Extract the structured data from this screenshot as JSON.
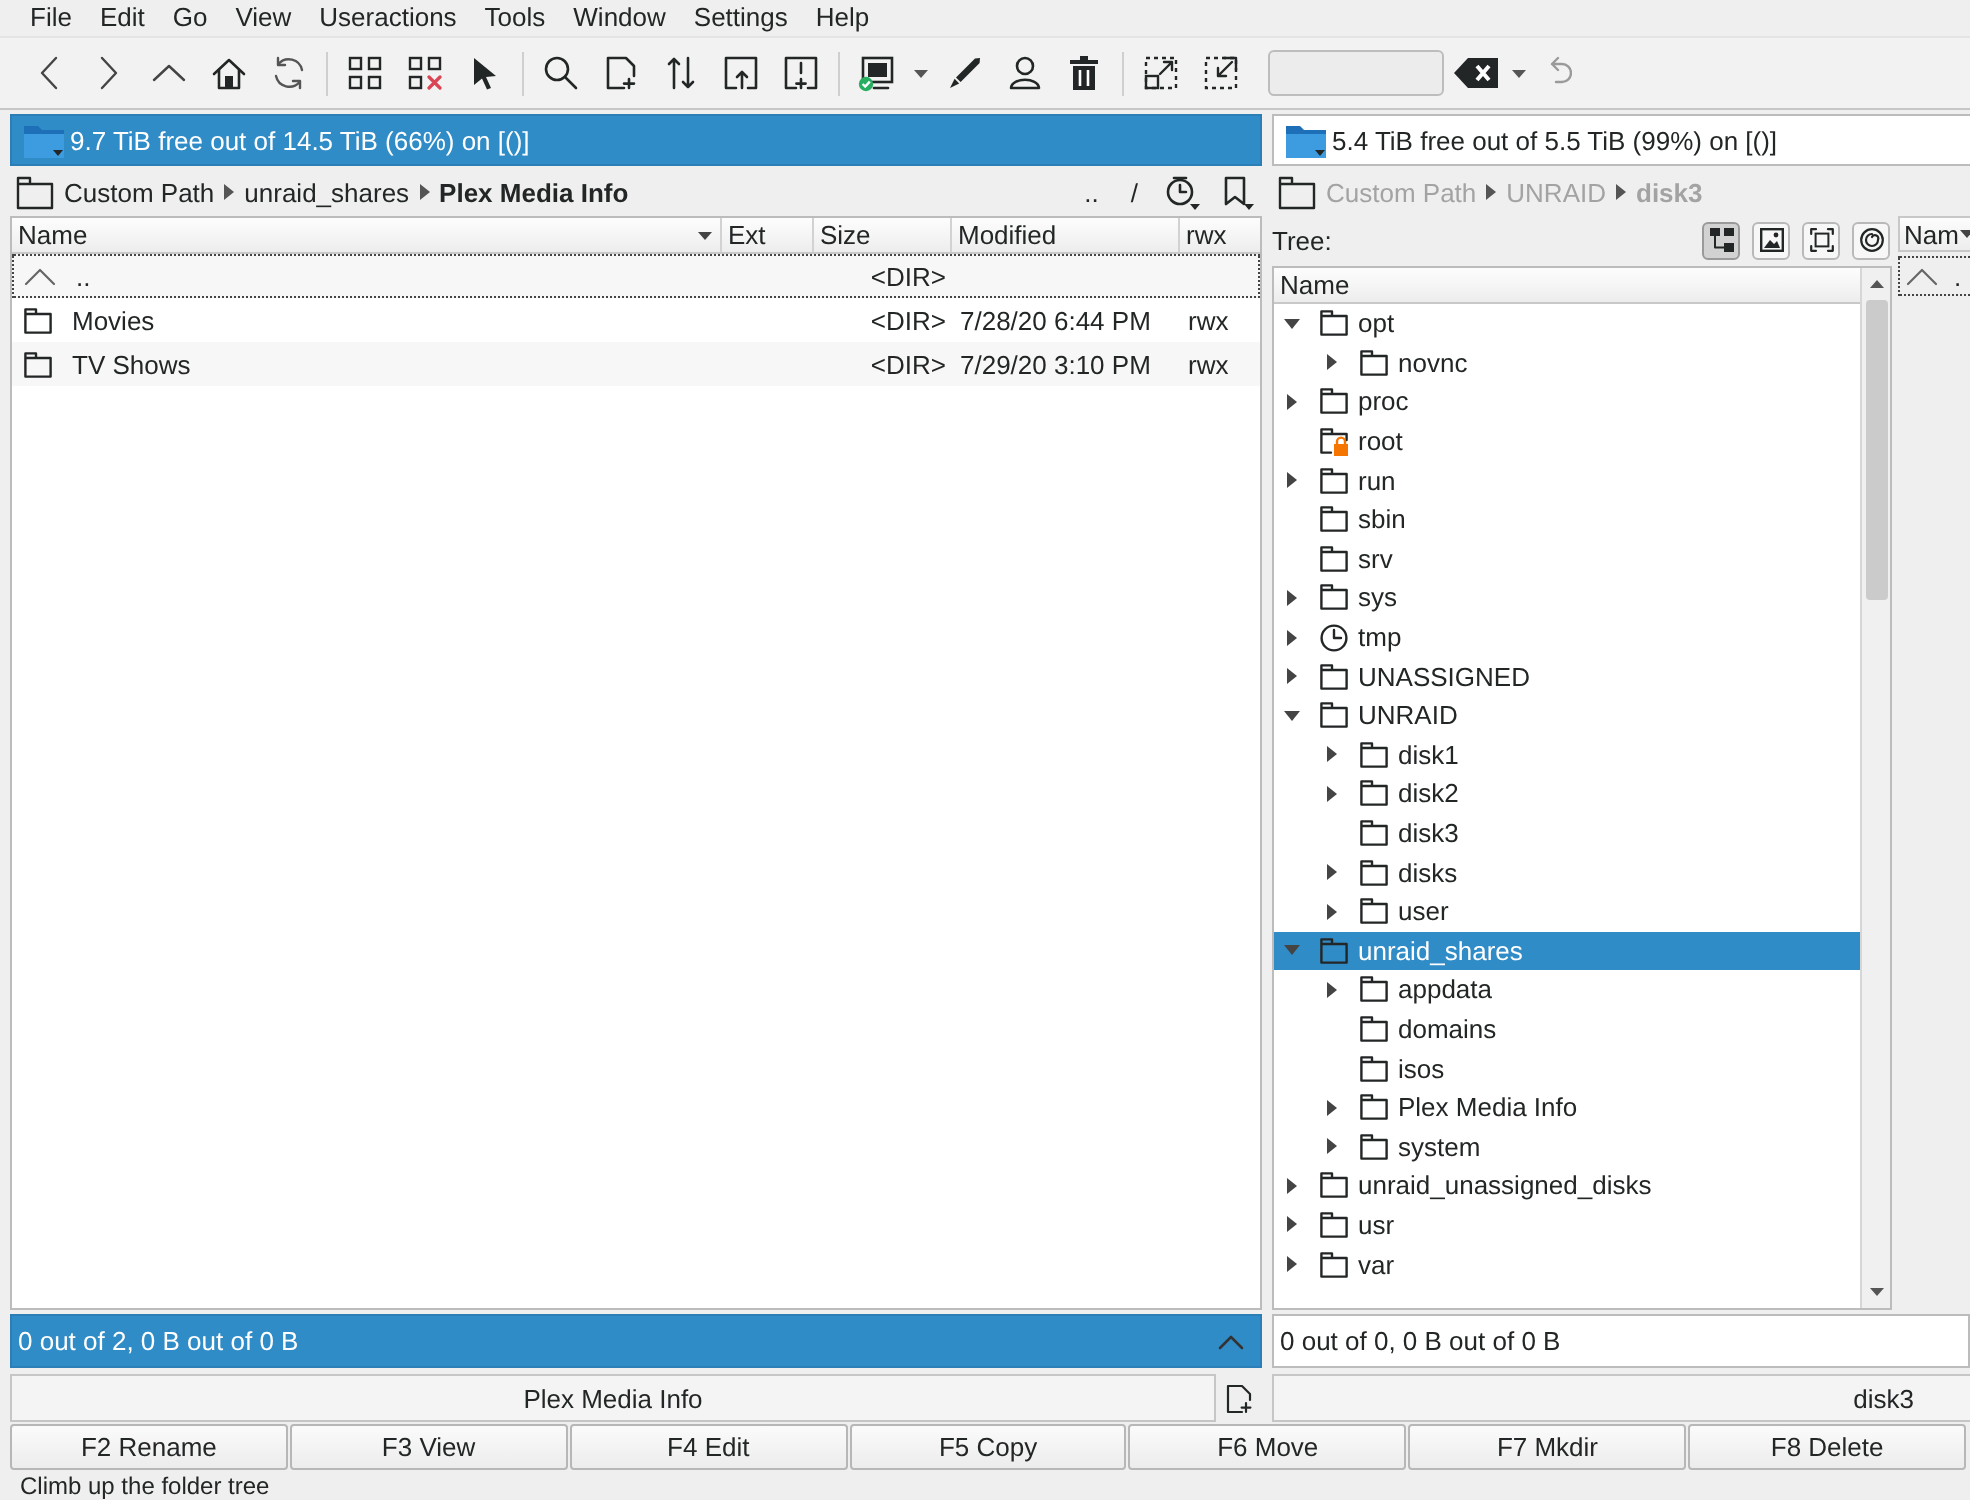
{
  "menu": [
    {
      "label": "File"
    },
    {
      "label": "Edit"
    },
    {
      "label": "Go"
    },
    {
      "label": "View"
    },
    {
      "label": "Useractions"
    },
    {
      "label": "Tools"
    },
    {
      "label": "Window"
    },
    {
      "label": "Settings"
    },
    {
      "label": "Help"
    }
  ],
  "left_panel": {
    "active": true,
    "free_space": "9.7 TiB free out of 14.5 TiB (66%) on [()]",
    "breadcrumb": [
      "Custom Path",
      "unraid_shares",
      "Plex Media Info"
    ],
    "nav_buttons": [
      "..",
      "/"
    ],
    "columns": [
      {
        "label": "Name",
        "sorted": true
      },
      {
        "label": "Ext",
        "sorted": false
      },
      {
        "label": "Size",
        "sorted": false
      },
      {
        "label": "Modified",
        "sorted": false
      },
      {
        "label": "rwx",
        "sorted": false
      }
    ],
    "rows": [
      {
        "kind": "up",
        "name": "..",
        "size": "<DIR>",
        "focused": true
      },
      {
        "kind": "folder",
        "name": "Movies",
        "size": "<DIR>",
        "modified": "7/28/20 6:44 PM",
        "rwx": "rwx",
        "focused": false
      },
      {
        "kind": "folder",
        "name": "TV Shows",
        "size": "<DIR>",
        "modified": "7/29/20 3:10 PM",
        "rwx": "rwx",
        "focused": false
      }
    ],
    "status": "0 out of 2, 0 B out of 0 B",
    "path_label": "Plex Media Info"
  },
  "right_panel": {
    "active": false,
    "free_space": "5.4 TiB free out of 5.5 TiB (99%) on [()]",
    "breadcrumb": [
      "Custom Path",
      "UNRAID",
      "disk3"
    ],
    "tree_label": "Tree:",
    "tree_buttons": [
      {
        "selected": true
      },
      {
        "selected": false
      },
      {
        "selected": false
      },
      {
        "selected": false
      }
    ],
    "tree": {
      "header": "Name",
      "items": [
        {
          "label": "opt",
          "kind": "folder",
          "expandable": true,
          "expanded": true,
          "selected": false,
          "children": [
            {
              "label": "novnc",
              "kind": "folder",
              "expandable": true,
              "expanded": false,
              "selected": false
            }
          ]
        },
        {
          "label": "proc",
          "kind": "folder",
          "expandable": true,
          "expanded": false,
          "selected": false
        },
        {
          "label": "root",
          "kind": "locked_folder",
          "expandable": false,
          "expanded": false,
          "selected": false
        },
        {
          "label": "run",
          "kind": "folder",
          "expandable": true,
          "expanded": false,
          "selected": false
        },
        {
          "label": "sbin",
          "kind": "folder",
          "expandable": false,
          "expanded": false,
          "selected": false
        },
        {
          "label": "srv",
          "kind": "folder",
          "expandable": false,
          "expanded": false,
          "selected": false
        },
        {
          "label": "sys",
          "kind": "folder",
          "expandable": true,
          "expanded": false,
          "selected": false
        },
        {
          "label": "tmp",
          "kind": "clock",
          "expandable": true,
          "expanded": false,
          "selected": false
        },
        {
          "label": "UNASSIGNED",
          "kind": "folder",
          "expandable": true,
          "expanded": false,
          "selected": false
        },
        {
          "label": "UNRAID",
          "kind": "folder",
          "expandable": true,
          "expanded": true,
          "selected": false,
          "children": [
            {
              "label": "disk1",
              "kind": "folder",
              "expandable": true,
              "expanded": false,
              "selected": false
            },
            {
              "label": "disk2",
              "kind": "folder",
              "expandable": true,
              "expanded": false,
              "selected": false
            },
            {
              "label": "disk3",
              "kind": "folder",
              "expandable": false,
              "expanded": false,
              "selected": false
            },
            {
              "label": "disks",
              "kind": "folder",
              "expandable": true,
              "expanded": false,
              "selected": false
            },
            {
              "label": "user",
              "kind": "folder",
              "expandable": true,
              "expanded": false,
              "selected": false
            }
          ]
        },
        {
          "label": "unraid_shares",
          "kind": "folder",
          "expandable": true,
          "expanded": true,
          "selected": true,
          "children": [
            {
              "label": "appdata",
              "kind": "folder",
              "expandable": true,
              "expanded": false,
              "selected": false
            },
            {
              "label": "domains",
              "kind": "folder",
              "expandable": false,
              "expanded": false,
              "selected": false
            },
            {
              "label": "isos",
              "kind": "folder",
              "expandable": false,
              "expanded": false,
              "selected": false
            },
            {
              "label": "Plex Media Info",
              "kind": "folder",
              "expandable": true,
              "expanded": false,
              "selected": false
            },
            {
              "label": "system",
              "kind": "folder",
              "expandable": true,
              "expanded": false,
              "selected": false
            }
          ]
        },
        {
          "label": "unraid_unassigned_disks",
          "kind": "folder",
          "expandable": true,
          "expanded": false,
          "selected": false
        },
        {
          "label": "usr",
          "kind": "folder",
          "expandable": true,
          "expanded": false,
          "selected": false
        },
        {
          "label": "var",
          "kind": "folder",
          "expandable": true,
          "expanded": false,
          "selected": false
        }
      ]
    },
    "file_list": {
      "columns": [
        {
          "label": "Nam",
          "sorted": true
        }
      ],
      "rows": [
        {
          "kind": "up",
          "name": ".",
          "focused": true
        }
      ]
    },
    "status": "0 out of 0, 0 B out of 0 B",
    "path_label": "disk3"
  },
  "function_keys": [
    "F2 Rename",
    "F3 View",
    "F4 Edit",
    "F5 Copy",
    "F6 Move",
    "F7 Mkdir",
    "F8 Delete"
  ],
  "status_message": "Climb up the folder tree"
}
